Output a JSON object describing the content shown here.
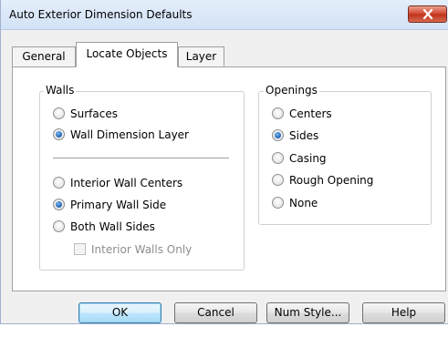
{
  "window": {
    "title": "Auto Exterior Dimension Defaults",
    "close_glyph": "✕"
  },
  "tabs": [
    {
      "label": "General",
      "selected": false
    },
    {
      "label": "Locate Objects",
      "selected": true
    },
    {
      "label": "Layer",
      "selected": false
    }
  ],
  "walls": {
    "legend": "Walls",
    "location_options": [
      {
        "label": "Surfaces",
        "selected": false
      },
      {
        "label": "Wall Dimension Layer",
        "selected": true
      }
    ],
    "side_options": [
      {
        "label": "Interior Wall Centers",
        "selected": false
      },
      {
        "label": "Primary Wall Side",
        "selected": true
      },
      {
        "label": "Both Wall Sides",
        "selected": false
      }
    ],
    "interior_walls_only": {
      "label": "Interior Walls Only",
      "checked": false,
      "enabled": false
    }
  },
  "openings": {
    "legend": "Openings",
    "options": [
      {
        "label": "Centers",
        "selected": false
      },
      {
        "label": "Sides",
        "selected": true
      },
      {
        "label": "Casing",
        "selected": false
      },
      {
        "label": "Rough Opening",
        "selected": false
      },
      {
        "label": "None",
        "selected": false
      }
    ]
  },
  "buttons": {
    "ok": "OK",
    "cancel": "Cancel",
    "num_style": "Num Style...",
    "help": "Help"
  },
  "colors": {
    "titlebar": "#d7e5f7",
    "close_button": "#c7432a",
    "radio_dot": "#1d5fb0",
    "default_button_border": "#3c7fb1"
  }
}
